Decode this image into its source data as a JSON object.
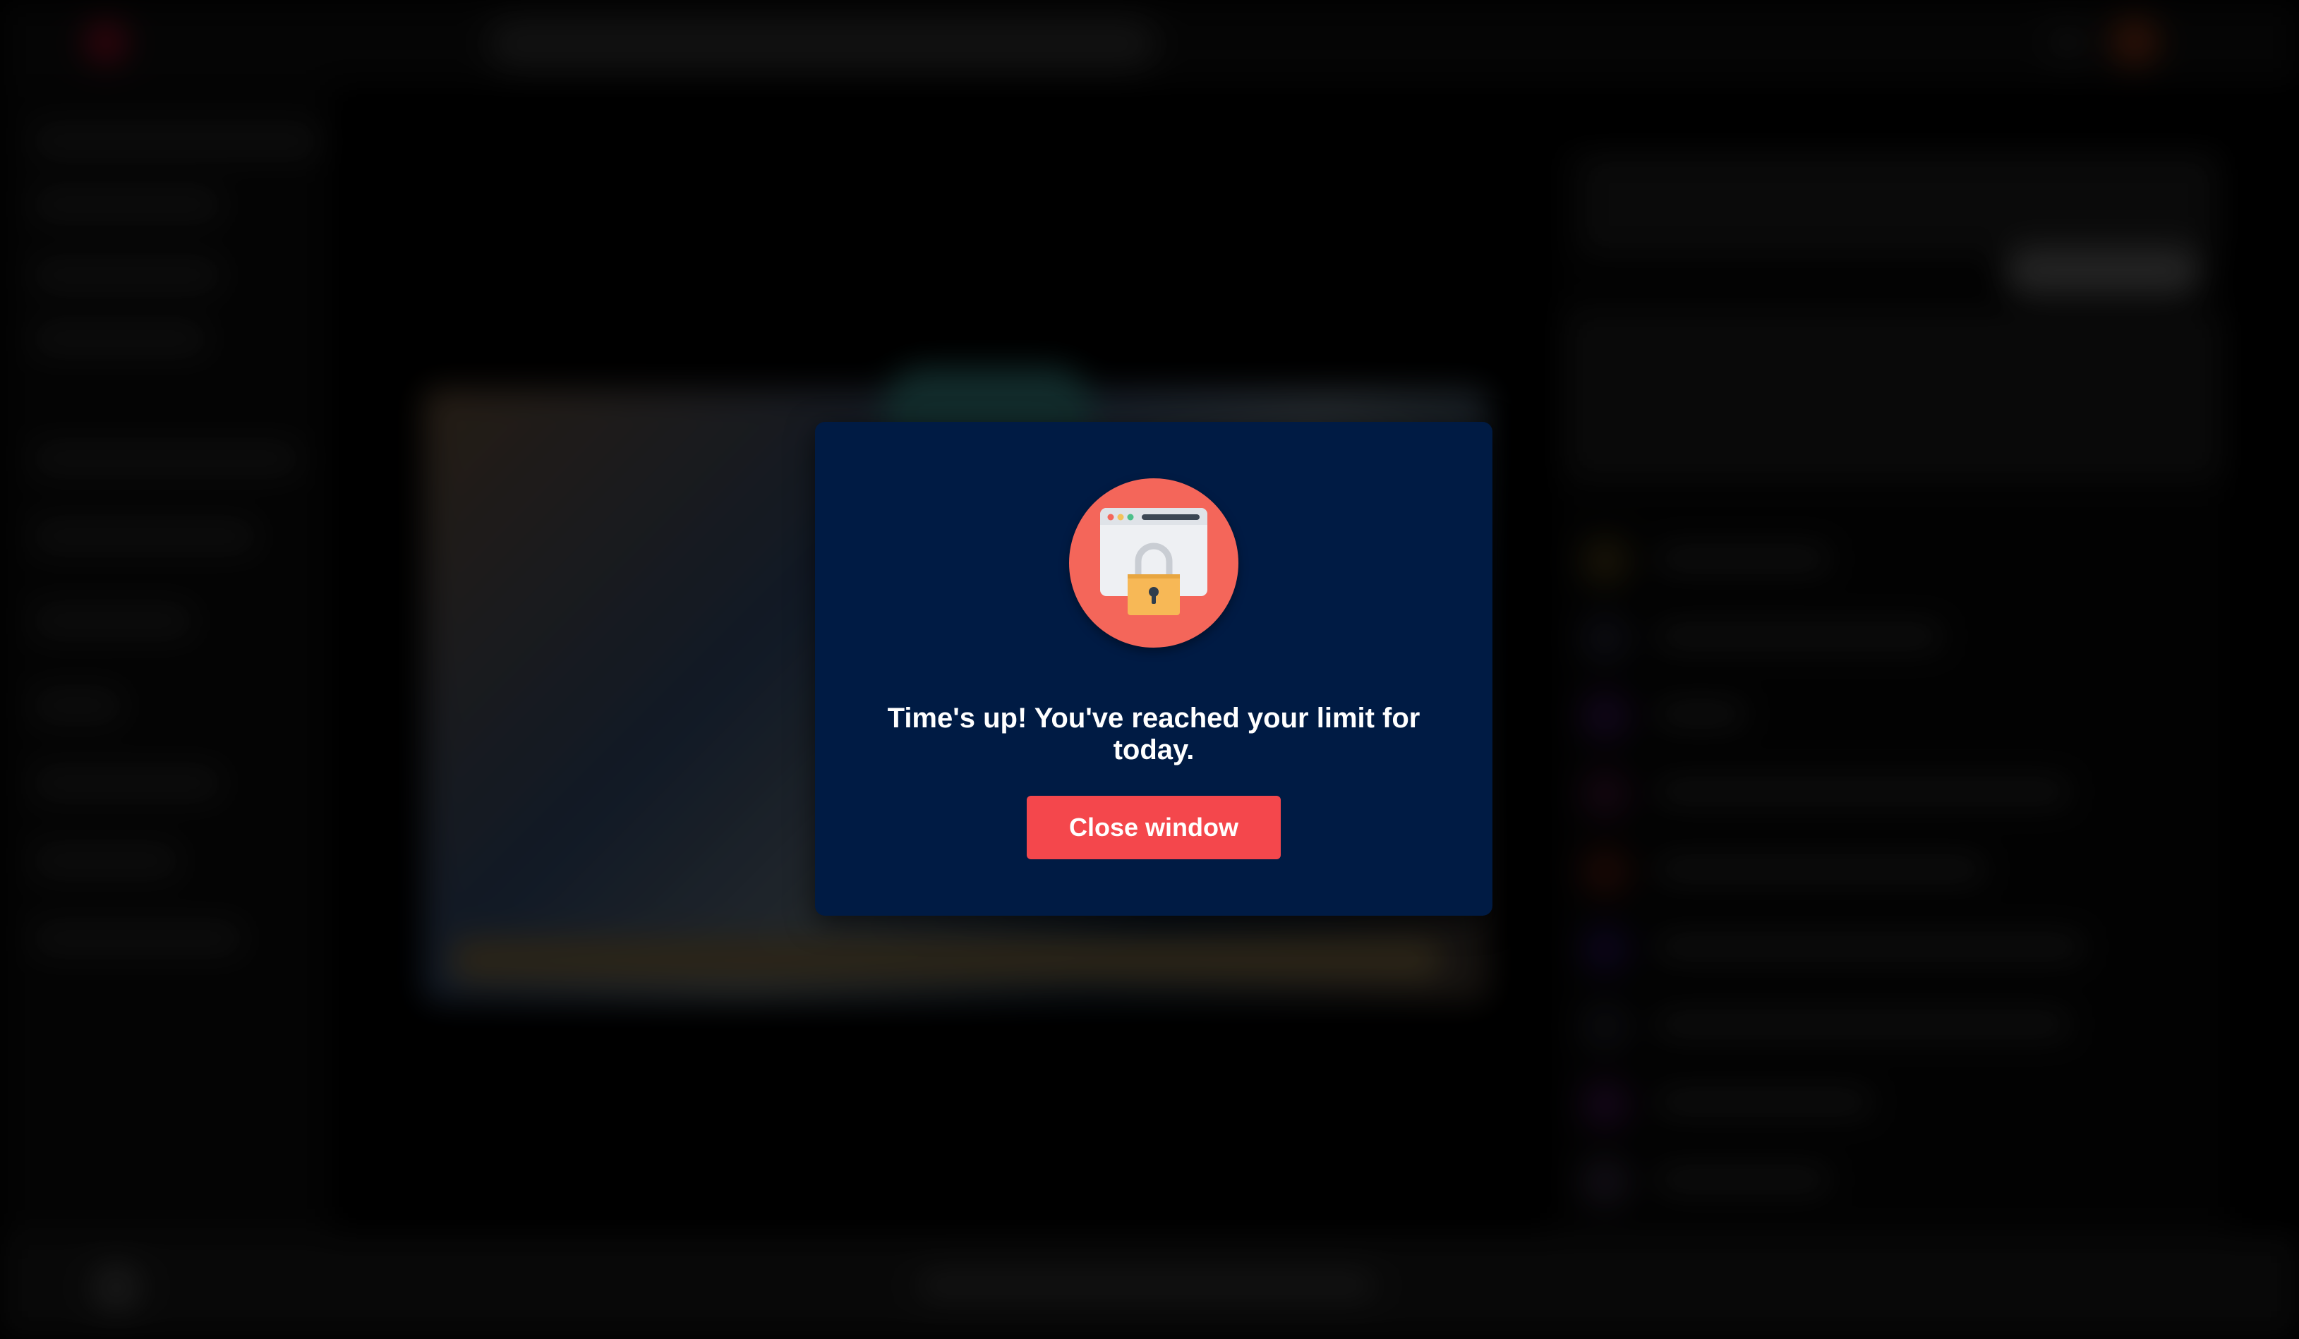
{
  "modal": {
    "message": "Time's up! You've reached your limit for today.",
    "close_button_label": "Close window",
    "icon": "browser-lock-icon",
    "colors": {
      "background": "#001b44",
      "accent": "#f4474c",
      "badge": "#f4665a"
    }
  },
  "background": {
    "state": "blurred"
  }
}
